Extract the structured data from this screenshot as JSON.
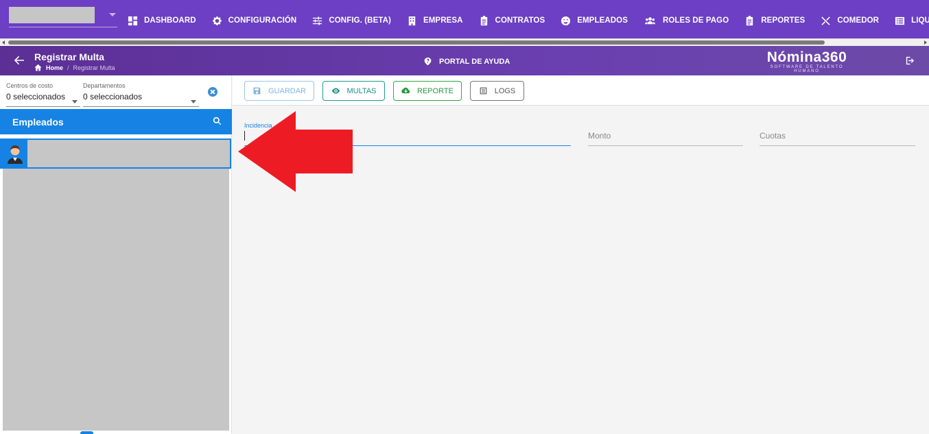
{
  "nav": {
    "items": [
      {
        "label": "DASHBOARD",
        "icon": "dashboard-icon"
      },
      {
        "label": "CONFIGURACIÓN",
        "icon": "gear-icon"
      },
      {
        "label": "CONFIG. (BETA)",
        "icon": "sliders-icon"
      },
      {
        "label": "EMPRESA",
        "icon": "building-icon"
      },
      {
        "label": "CONTRATOS",
        "icon": "clipboard-icon"
      },
      {
        "label": "EMPLEADOS",
        "icon": "face-icon"
      },
      {
        "label": "ROLES DE PAGO",
        "icon": "people-icon"
      },
      {
        "label": "REPORTES",
        "icon": "clipboard-report-icon"
      },
      {
        "label": "COMEDOR",
        "icon": "utensils-icon"
      },
      {
        "label": "LIQUIDACIONES",
        "icon": "list-icon"
      }
    ]
  },
  "header": {
    "title": "Registrar Multa",
    "breadcrumb_home": "Home",
    "breadcrumb_sep": "/",
    "breadcrumb_current": "Registrar Multa",
    "help": "PORTAL DE AYUDA",
    "brand": "Nómina360",
    "brand_tagline": "SOFTWARE DE TALENTO HUMANO"
  },
  "filters": {
    "cost_centers": {
      "label": "Centros de costo",
      "value": "0 seleccionados"
    },
    "departments": {
      "label": "Departamentos",
      "value": "0 seleccionados"
    }
  },
  "employees": {
    "title": "Empleados"
  },
  "toolbar": {
    "save": "GUARDAR",
    "multas": "MULTAS",
    "reporte": "REPORTE",
    "logs": "LOGS"
  },
  "form": {
    "incidencia_label": "Incidencia",
    "monto_label": "Monto",
    "cuotas_label": "Cuotas"
  },
  "colors": {
    "nav_bg": "#6c3fc4",
    "header_bg": "#5b2f94",
    "accent_blue": "#1683e4",
    "annotation_red": "#ed1c24"
  }
}
